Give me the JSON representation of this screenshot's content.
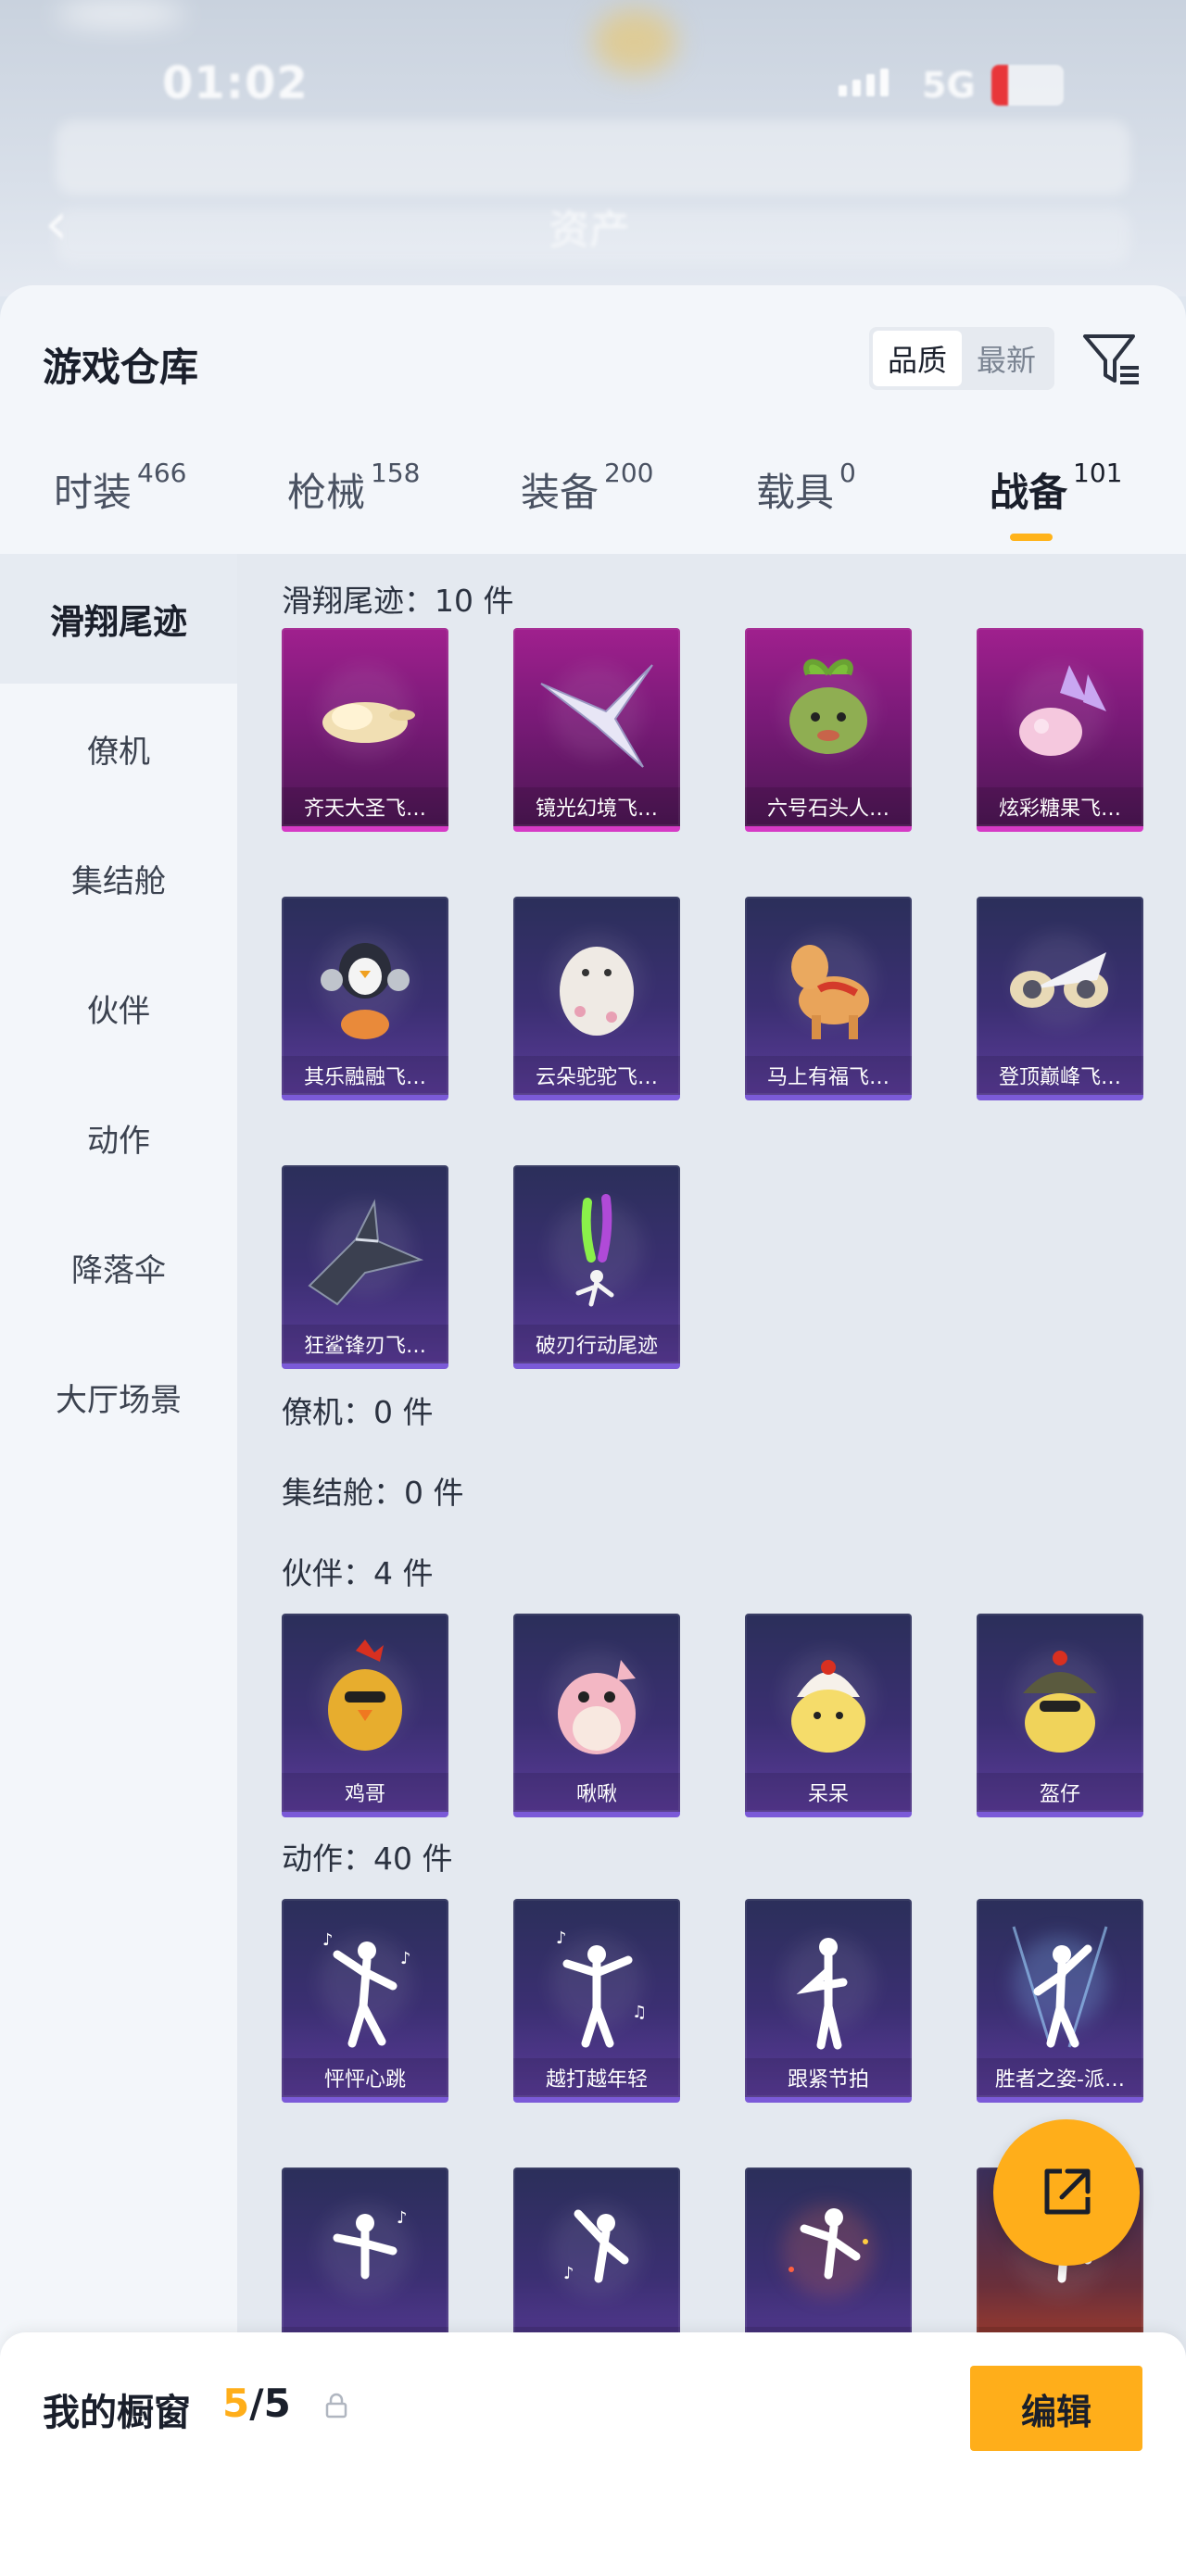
{
  "status_bar": {
    "time": "01:02",
    "network": "5G",
    "battery": "19"
  },
  "header": {
    "title": "资产",
    "back_icon": "chevron-left-icon"
  },
  "sheet": {
    "title": "游戏仓库",
    "sort": {
      "options": [
        "品质",
        "最新"
      ],
      "selected": "品质"
    },
    "filter_icon": "filter-list-icon"
  },
  "tabs": [
    {
      "label": "时装",
      "count": "466"
    },
    {
      "label": "枪械",
      "count": "158"
    },
    {
      "label": "装备",
      "count": "200"
    },
    {
      "label": "载具",
      "count": "0"
    },
    {
      "label": "战备",
      "count": "101",
      "active": true
    }
  ],
  "sidebar": {
    "items": [
      {
        "label": "滑翔尾迹",
        "active": true
      },
      {
        "label": "僚机"
      },
      {
        "label": "集结舱"
      },
      {
        "label": "伙伴"
      },
      {
        "label": "动作"
      },
      {
        "label": "降落伞"
      },
      {
        "label": "大厅场景"
      }
    ]
  },
  "sections": {
    "glide": {
      "title": "滑翔尾迹：10 件",
      "items": [
        {
          "name": "齐天大圣飞…",
          "rarity": "pink"
        },
        {
          "name": "镜光幻境飞…",
          "rarity": "pink"
        },
        {
          "name": "六号石头人…",
          "rarity": "pink"
        },
        {
          "name": "炫彩糖果飞…",
          "rarity": "pink"
        },
        {
          "name": "其乐融融飞…",
          "rarity": "purple"
        },
        {
          "name": "云朵驼驼飞…",
          "rarity": "purple"
        },
        {
          "name": "马上有福飞…",
          "rarity": "purple"
        },
        {
          "name": "登顶巅峰飞…",
          "rarity": "purple"
        },
        {
          "name": "狂鲨锋刃飞…",
          "rarity": "purple"
        },
        {
          "name": "破刃行动尾迹",
          "rarity": "purple"
        }
      ]
    },
    "wingman": {
      "title": "僚机：0 件"
    },
    "pod": {
      "title": "集结舱：0 件"
    },
    "partner": {
      "title": "伙伴：4 件",
      "items": [
        {
          "name": "鸡哥"
        },
        {
          "name": "啾啾"
        },
        {
          "name": "呆呆"
        },
        {
          "name": "盔仔"
        }
      ]
    },
    "emote": {
      "title": "动作：40 件",
      "items": [
        {
          "name": "怦怦心跳"
        },
        {
          "name": "越打越年轻"
        },
        {
          "name": "跟紧节拍"
        },
        {
          "name": "胜者之姿-派…"
        },
        {
          "name": ""
        },
        {
          "name": ""
        },
        {
          "name": ""
        },
        {
          "name": ""
        }
      ]
    }
  },
  "share_icon": "share-external-icon",
  "showcase": {
    "label": "我的橱窗",
    "current": "5",
    "total": "/5",
    "lock_icon": "lock-icon",
    "edit_label": "编辑"
  },
  "colors": {
    "accent": "#ffae1a",
    "pink_rarity": "#a0208e",
    "purple_rarity": "#3b2f72"
  }
}
